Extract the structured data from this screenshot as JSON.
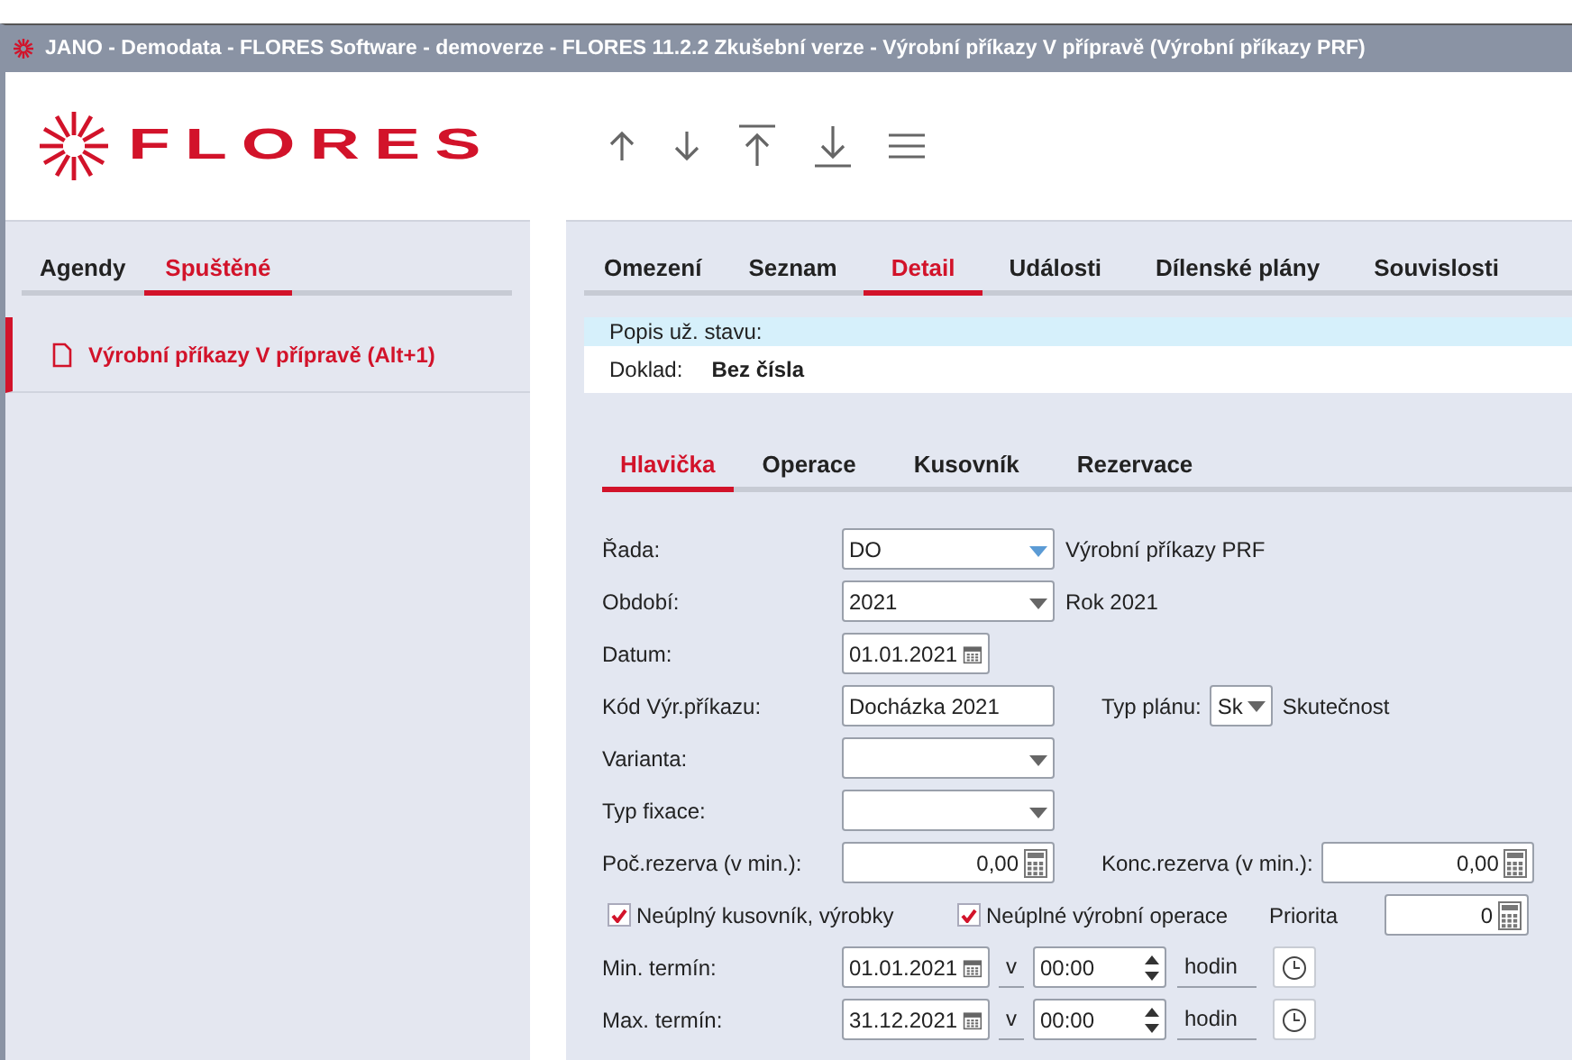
{
  "window": {
    "title": "JANO - Demodata - FLORES Software - demoverze - FLORES 11.2.2 Zkušební verze - Výrobní příkazy V přípravě  (Výrobní příkazy PRF)"
  },
  "logo": {
    "text": "FLORES"
  },
  "sidebar": {
    "tabs": [
      {
        "label": "Agendy",
        "selected": false
      },
      {
        "label": "Spuštěné",
        "selected": true
      }
    ],
    "items": [
      {
        "label": "Výrobní příkazy V přípravě (Alt+1)",
        "selected": true
      }
    ]
  },
  "tabs": [
    {
      "label": "Omezení",
      "selected": false
    },
    {
      "label": "Seznam",
      "selected": false
    },
    {
      "label": "Detail",
      "selected": true
    },
    {
      "label": "Události",
      "selected": false
    },
    {
      "label": "Dílenské plány",
      "selected": false
    },
    {
      "label": "Souvislosti",
      "selected": false
    }
  ],
  "status": {
    "label": "Popis už. stavu:"
  },
  "document": {
    "label": "Doklad:",
    "value": "Bez čísla"
  },
  "subtabs": [
    {
      "label": "Hlavička",
      "selected": true
    },
    {
      "label": "Operace",
      "selected": false
    },
    {
      "label": "Kusovník",
      "selected": false
    },
    {
      "label": "Rezervace",
      "selected": false
    }
  ],
  "form": [
    {
      "label": "Řada:",
      "items": [
        {
          "kind": "combo",
          "value": "DO",
          "accent": true
        },
        {
          "kind": "note",
          "text": "Výrobní příkazy PRF"
        }
      ]
    },
    {
      "label": "Období:",
      "items": [
        {
          "kind": "combo",
          "value": "2021",
          "accent": false
        },
        {
          "kind": "note",
          "text": "Rok 2021"
        }
      ]
    },
    {
      "label": "Datum:",
      "items": [
        {
          "kind": "date",
          "value": "01.01.2021"
        }
      ]
    },
    {
      "label": "Kód Výr.příkazu:",
      "items": [
        {
          "kind": "text",
          "value": "Docházka 2021"
        }
      ],
      "extra": {
        "label": "Typ plánu:",
        "items": [
          {
            "kind": "small_combo",
            "value": "Sk"
          },
          {
            "kind": "note",
            "text": "Skutečnost"
          }
        ]
      }
    },
    {
      "label": "Varianta:",
      "items": [
        {
          "kind": "combo",
          "accent": false
        }
      ]
    },
    {
      "label": "Typ fixace:",
      "items": [
        {
          "kind": "combo",
          "accent": false
        }
      ]
    },
    {
      "label": "Poč.rezerva (v min.):",
      "items": [
        {
          "kind": "number",
          "value": "0,00"
        }
      ],
      "extra": {
        "label": "Konc.rezerva (v min.):",
        "items": [
          {
            "kind": "number",
            "value": "0,00"
          }
        ]
      }
    }
  ],
  "checks": [
    {
      "label": "Neúplný kusovník, výrobky",
      "checked": true
    },
    {
      "label": "Neúplné výrobní operace",
      "checked": true
    }
  ],
  "priority": {
    "label": "Priorita",
    "value": "0"
  },
  "terms": [
    {
      "label": "Min. termín:",
      "date": "01.01.2021",
      "at": "v",
      "time": "00:00",
      "unit": "hodin"
    },
    {
      "label": "Max. termín:",
      "date": "31.12.2021",
      "at": "v",
      "time": "00:00",
      "unit": "hodin"
    }
  ]
}
